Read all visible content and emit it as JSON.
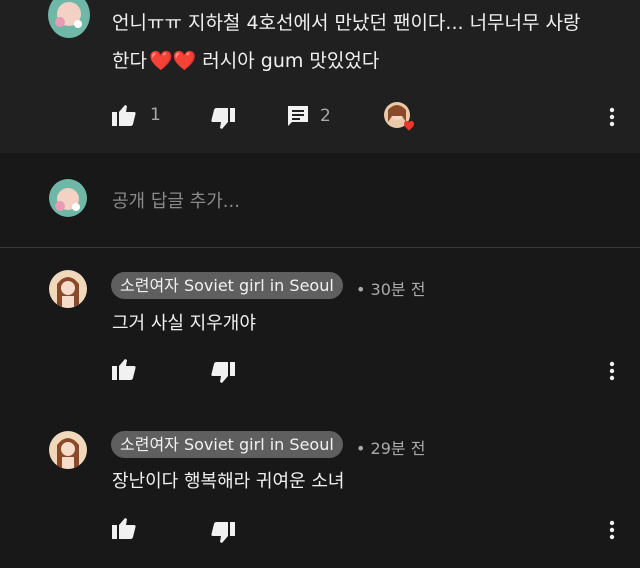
{
  "top_comment": {
    "line1": "언니ㅠㅠ 지하철 4호선에서 만났던 팬이다... 너무너무 사랑",
    "line2_start": "한다",
    "hearts": "❤️❤️",
    "line2_end": "러시아 gum 맛있었다",
    "like_count": "1",
    "reply_count": "2"
  },
  "reply_input": {
    "placeholder": "공개 답글 추가..."
  },
  "replies": [
    {
      "author": "소련여자 Soviet girl in Seoul",
      "time": "• 30분 전",
      "text": "그거 사실 지우개야"
    },
    {
      "author": "소련여자 Soviet girl in Seoul",
      "time": "• 29분 전",
      "text": "장난이다 행복해라 귀여운 소녀"
    }
  ],
  "colors": {
    "background": "#181818",
    "top_block": "#202020",
    "chip": "#5f5f5f",
    "heart": "#e8392a"
  }
}
